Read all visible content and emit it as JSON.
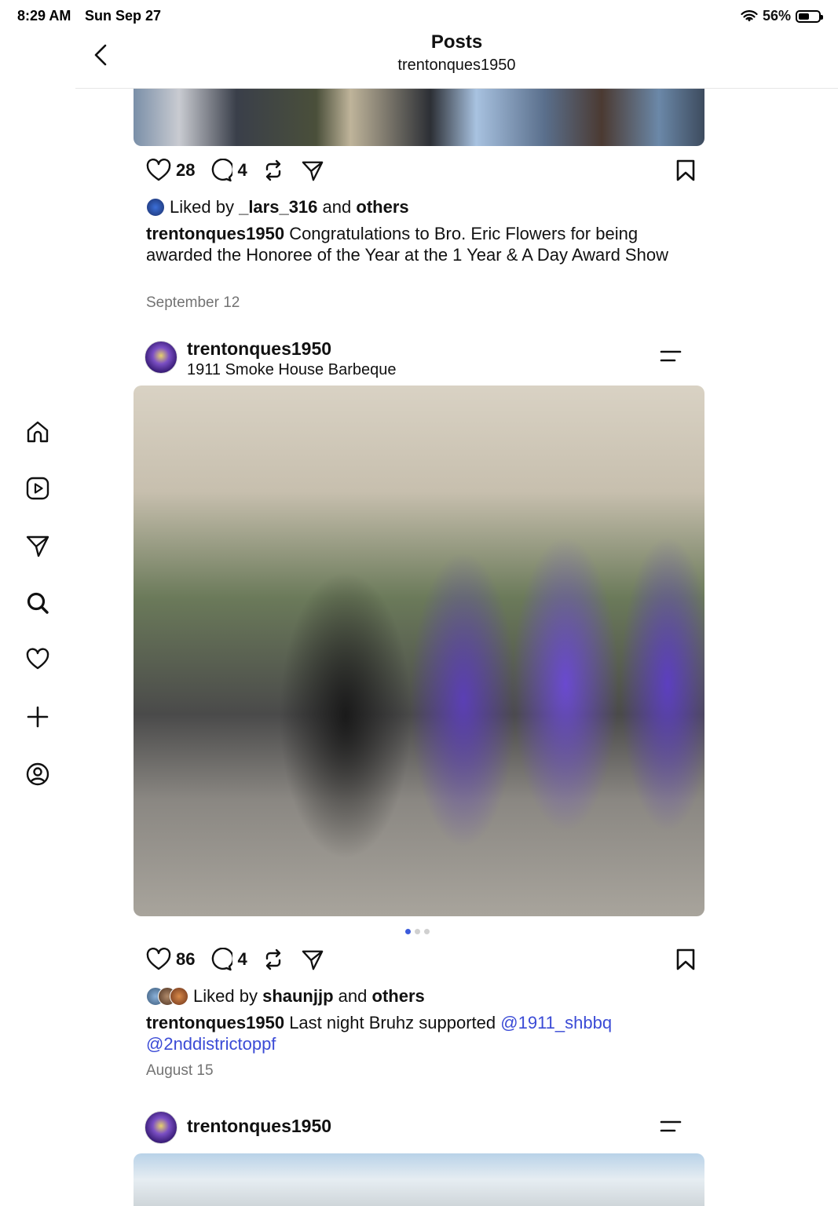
{
  "status_bar": {
    "time": "8:29 AM",
    "date": "Sun Sep 27",
    "battery": "56%",
    "battery_level": 0.56
  },
  "header": {
    "title": "Posts",
    "subtitle": "trentonques1950"
  },
  "sidebar": {
    "items": [
      {
        "icon": "home-icon"
      },
      {
        "icon": "reels-icon"
      },
      {
        "icon": "direct-message-icon"
      },
      {
        "icon": "search-icon"
      },
      {
        "icon": "heart-icon"
      },
      {
        "icon": "create-icon"
      },
      {
        "icon": "profile-icon"
      }
    ]
  },
  "posts": [
    {
      "likes": "28",
      "comments": "4",
      "liked_by_prefix": "Liked by",
      "liked_by_user": "_lars_316",
      "liked_by_and": "and",
      "liked_by_others": "others",
      "caption_user": "trentonques1950",
      "caption_text": "Congratulations to Bro. Eric Flowers for being awarded the Honoree of the Year at the 1 Year & A Day Award Show",
      "date": "September 12"
    },
    {
      "username": "trentonques1950",
      "location": "1911 Smoke House Barbeque",
      "likes": "86",
      "comments": "4",
      "liked_by_prefix": "Liked by",
      "liked_by_user": "shaunjjp",
      "liked_by_and": "and",
      "liked_by_others": "others",
      "caption_user": "trentonques1950",
      "caption_text": "Last night Bruhz supported",
      "mention_1": "@1911_shbbq",
      "mention_2": "@2nddistrictoppf",
      "date": "August 15",
      "carousel_total": 3,
      "carousel_active": 1
    },
    {
      "username": "trentonques1950"
    }
  ]
}
